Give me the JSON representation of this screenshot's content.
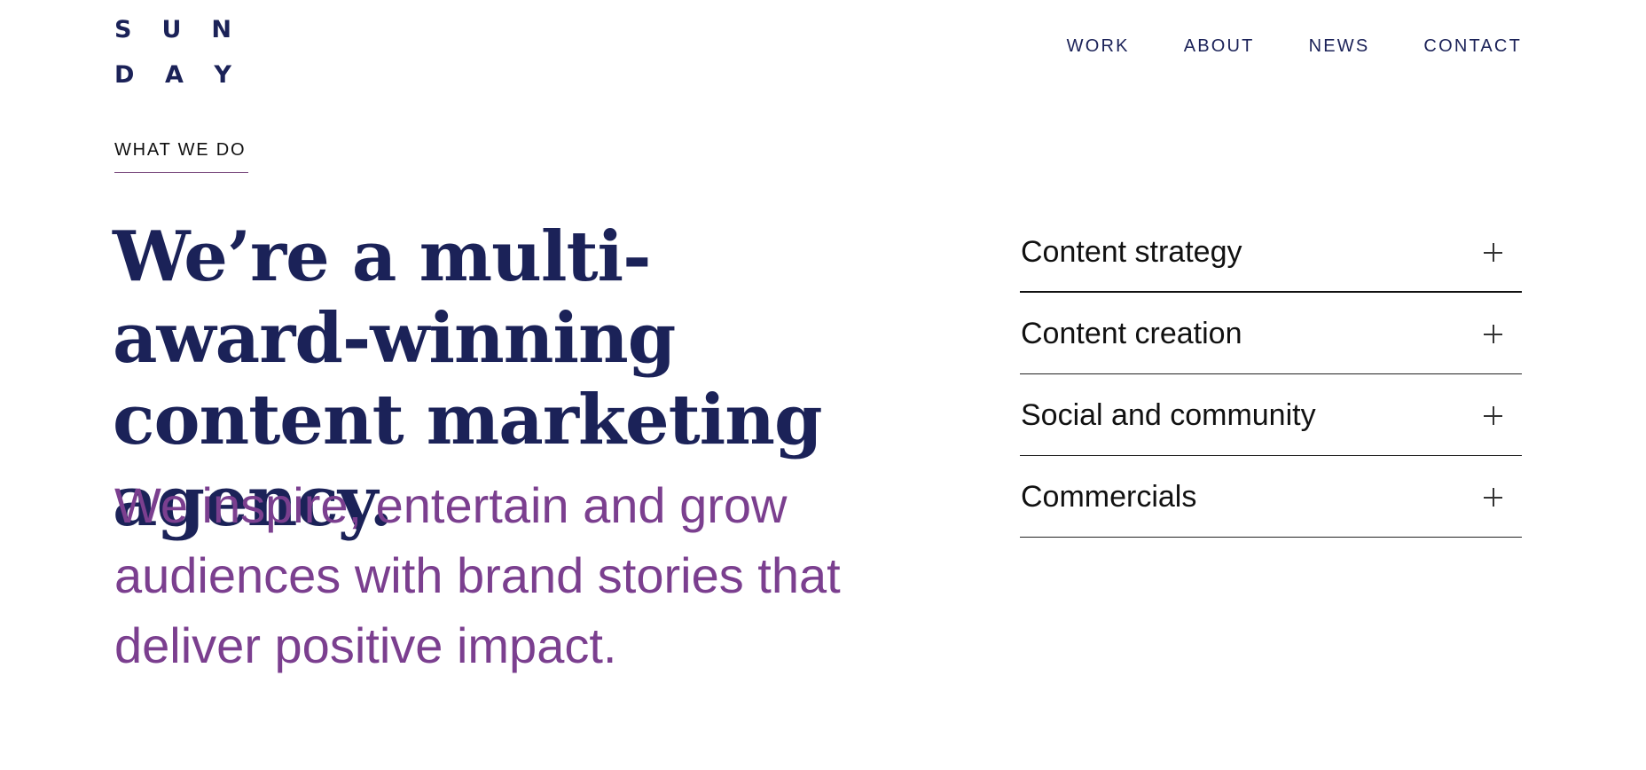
{
  "header": {
    "logo": {
      "line1": [
        "S",
        "U",
        "N"
      ],
      "line2": [
        "D",
        "A",
        "Y"
      ]
    },
    "nav": [
      "WORK",
      "ABOUT",
      "NEWS",
      "CONTACT"
    ]
  },
  "section": {
    "eyebrow": "WHAT WE DO",
    "headline": "We’re a multi-award-winning content marketing agency.",
    "subhead": "We inspire, entertain and grow audiences with brand stories that deliver positive impact."
  },
  "services": [
    {
      "label": "Content strategy",
      "icon": "plus-icon"
    },
    {
      "label": "Content creation",
      "icon": "plus-icon"
    },
    {
      "label": "Social and community",
      "icon": "plus-icon"
    },
    {
      "label": "Commercials",
      "icon": "plus-icon"
    }
  ],
  "colors": {
    "navy": "#1b2258",
    "purple": "#7b3f8f",
    "text": "#111111",
    "background": "#ffffff"
  }
}
